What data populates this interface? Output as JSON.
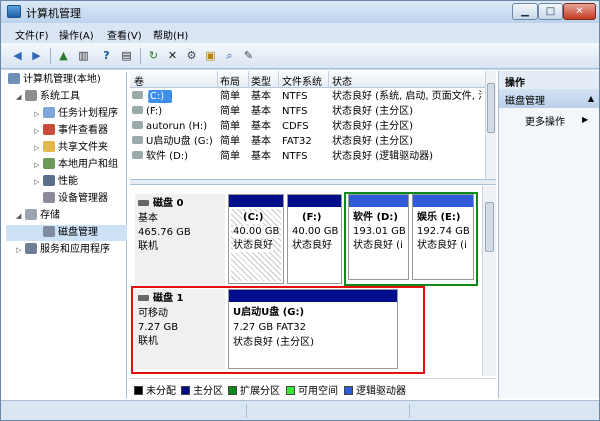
{
  "window": {
    "title": "计算机管理"
  },
  "menu": [
    "文件(F)",
    "操作(A)",
    "查看(V)",
    "帮助(H)"
  ],
  "colors": {
    "primary_bar": "#000e8c",
    "extended_frame": "#0e8a1c",
    "highlight": "#e21010"
  },
  "toolbar": {
    "back": "◀",
    "forward": "▶",
    "up": "▲",
    "show_tree": "▥",
    "help": "?",
    "props": "▤",
    "refresh": "↻",
    "delete": "✕",
    "props2": "⚙",
    "open": "▣",
    "search": "⌕",
    "export": "✎"
  },
  "tree": [
    {
      "label": "计算机管理(本地)",
      "indent": 0,
      "arrow": ""
    },
    {
      "label": "系统工具",
      "indent": 1,
      "arrow": "◢"
    },
    {
      "label": "任务计划程序",
      "indent": 2,
      "arrow": "▷"
    },
    {
      "label": "事件查看器",
      "indent": 2,
      "arrow": "▷"
    },
    {
      "label": "共享文件夹",
      "indent": 2,
      "arrow": "▷"
    },
    {
      "label": "本地用户和组",
      "indent": 2,
      "arrow": "▷"
    },
    {
      "label": "性能",
      "indent": 2,
      "arrow": "▷"
    },
    {
      "label": "设备管理器",
      "indent": 2,
      "arrow": ""
    },
    {
      "label": "存储",
      "indent": 1,
      "arrow": "◢"
    },
    {
      "label": "磁盘管理",
      "indent": 2,
      "arrow": "",
      "selected": true
    },
    {
      "label": "服务和应用程序",
      "indent": 1,
      "arrow": "▷"
    }
  ],
  "volumes": {
    "headers": [
      "卷",
      "布局",
      "类型",
      "文件系统",
      "状态"
    ],
    "rows": [
      {
        "name": "(C:)",
        "layout": "简单",
        "type": "基本",
        "fs": "NTFS",
        "status": "状态良好 (系统, 启动, 页面文件, 活"
      },
      {
        "name": "(F:)",
        "layout": "简单",
        "type": "基本",
        "fs": "NTFS",
        "status": "状态良好 (主分区)"
      },
      {
        "name": "autorun (H:)",
        "layout": "简单",
        "type": "基本",
        "fs": "CDFS",
        "status": "状态良好 (主分区)"
      },
      {
        "name": "U启动U盘 (G:)",
        "layout": "简单",
        "type": "基本",
        "fs": "FAT32",
        "status": "状态良好 (主分区)"
      },
      {
        "name": "软件 (D:)",
        "layout": "简单",
        "type": "基本",
        "fs": "NTFS",
        "status": "状态良好 (逻辑驱动器)"
      }
    ]
  },
  "disks": [
    {
      "name": "磁盘 0",
      "type": "基本",
      "size": "465.76 GB",
      "state": "联机",
      "partitions": [
        {
          "label": "(C:)",
          "size": "40.00 GB",
          "status": "状态良好"
        },
        {
          "label": "(F:)",
          "size": "40.00 GB",
          "status": "状态良好"
        },
        {
          "label": "软件  (D:)",
          "size": "193.01 GB",
          "status": "状态良好 (i"
        },
        {
          "label": "娱乐  (E:)",
          "size": "192.74 GB",
          "status": "状态良好 (i"
        }
      ]
    },
    {
      "name": "磁盘 1",
      "type": "可移动",
      "size": "7.27 GB",
      "state": "联机",
      "partitions": [
        {
          "label": "U启动U盘  (G:)",
          "size": "7.27 GB FAT32",
          "status": "状态良好 (主分区)"
        }
      ]
    }
  ],
  "legend": [
    {
      "label": "未分配",
      "color": "#000000"
    },
    {
      "label": "主分区",
      "color": "#000e8c"
    },
    {
      "label": "扩展分区",
      "color": "#0e8a1c"
    },
    {
      "label": "可用空间",
      "color": "#3ee63a"
    },
    {
      "label": "逻辑驱动器",
      "color": "#2f5ad8"
    }
  ],
  "actions": {
    "title": "操作",
    "section": "磁盘管理",
    "more": "更多操作"
  }
}
